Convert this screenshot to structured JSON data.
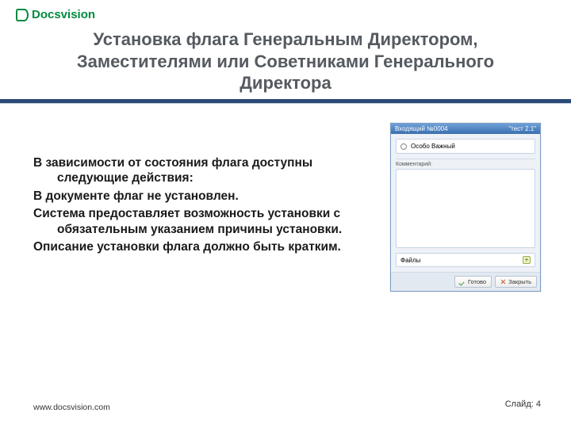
{
  "brand": "Docsvision",
  "slide_title": "Установка флага Генеральным Директором, Заместителями или Советниками Генерального Директора",
  "paragraphs": [
    "В зависимости от состояния флага доступны следующие действия:",
    "В документе флаг не установлен.",
    "Система предоставляет возможность установки с обязательным указанием причины установки.",
    "Описание установки флага должно быть кратким."
  ],
  "app": {
    "title_left": "Входящий №0004",
    "title_right": "\"тест 2.1\"",
    "option": "Особо Важный",
    "comment_label": "Комментарий:",
    "files_label": "Файлы",
    "ok": "Готово",
    "close": "Закрыть"
  },
  "footer": {
    "url": "www.docsvision.com",
    "slide_label": "Слайд:",
    "slide_num": "4"
  }
}
